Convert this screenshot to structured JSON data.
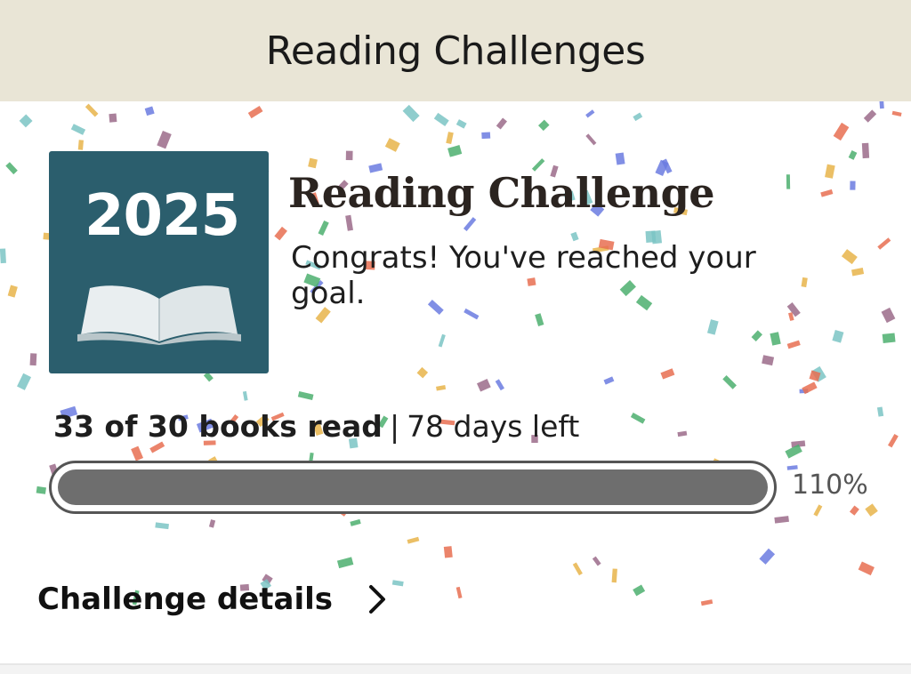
{
  "header": {
    "title": "Reading Challenges"
  },
  "badge": {
    "year": "2025",
    "icon": "open-book-icon"
  },
  "challenge": {
    "title": "Reading Challenge",
    "message": "Congrats! You've reached your goal."
  },
  "progress": {
    "read_text": "33 of 30 books read",
    "separator": "|",
    "days_left_text": "78 days left",
    "percent_label": "110%",
    "fill_fraction": 1.0
  },
  "details": {
    "label": "Challenge details",
    "icon": "chevron-right-icon"
  },
  "colors": {
    "header_bg": "#e9e5d6",
    "badge_bg": "#2b5e6d",
    "progress_fill": "#6e6e6e",
    "confetti": [
      "#e8b44a",
      "#4caf6e",
      "#6b7be0",
      "#e76f51",
      "#9b6b8a",
      "#7bc4c4"
    ]
  }
}
